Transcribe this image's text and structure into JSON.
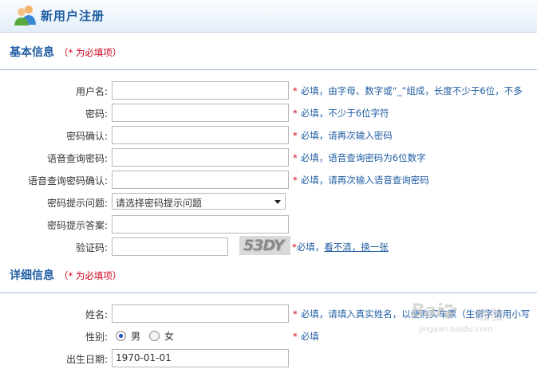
{
  "header": {
    "title": "新用户注册",
    "icon": "users-icon"
  },
  "basic": {
    "title": "基本信息",
    "note": "（* 为必填项）",
    "fields": [
      {
        "label": "用户名:",
        "value": "",
        "star": "*",
        "hint": "必填，由字母、数字或“_”组成，长度不少于6位，不多"
      },
      {
        "label": "密码:",
        "value": "",
        "star": "*",
        "hint": "必填，不少于6位字符"
      },
      {
        "label": "密码确认:",
        "value": "",
        "star": "*",
        "hint": "必填，请再次输入密码"
      },
      {
        "label": "语音查询密码:",
        "value": "",
        "star": "*",
        "hint": "必填，语音查询密码为6位数字"
      },
      {
        "label": "语音查询密码确认:",
        "value": "",
        "star": "*",
        "hint": "必填，请再次输入语音查询密码"
      }
    ],
    "question": {
      "label": "密码提示问题:",
      "selected": "请选择密码提示问题"
    },
    "answer": {
      "label": "密码提示答案:",
      "value": ""
    },
    "captcha": {
      "label": "验证码:",
      "value": "",
      "code": "53DY",
      "star": "*",
      "required": "必填，",
      "refresh_link": "看不清，换一张"
    }
  },
  "detail": {
    "title": "详细信息",
    "note": "（* 为必填项）",
    "name": {
      "label": "姓名:",
      "value": "",
      "star": "*",
      "hint": "必填，请填入真实姓名，以便购买车票（生僻字请用小写"
    },
    "gender": {
      "label": "性别:",
      "options": [
        "男",
        "女"
      ],
      "selected": "男",
      "star": "*",
      "hint": "必填"
    },
    "birth": {
      "label": "出生日期:",
      "value": "1970-01-01"
    }
  },
  "watermark": {
    "brand": "Bai",
    "brand_cn": "经验",
    "url": "jingyan.baidu.com"
  },
  "colors": {
    "accent": "#1f5da2",
    "required": "#d0021b",
    "header_bg": "#e3eef9"
  }
}
